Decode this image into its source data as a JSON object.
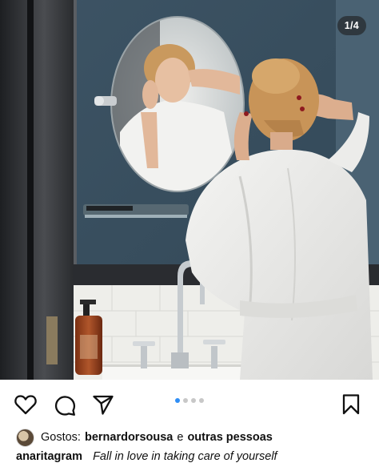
{
  "post": {
    "image_counter": "1/4",
    "carousel": {
      "total": 4,
      "active_index": 0
    },
    "likes": {
      "prefix": "Gostos:",
      "user": "bernardorsousa",
      "joiner": "e",
      "others": "outras pessoas"
    },
    "caption": {
      "username": "anaritagram",
      "text": "Fall in love in taking care of yourself"
    }
  },
  "actions": {
    "like_icon": "heart-icon",
    "comment_icon": "comment-icon",
    "share_icon": "send-icon",
    "save_icon": "bookmark-icon"
  },
  "colors": {
    "accent_dot": "#2f8ef5",
    "inactive_dot": "#c8c8c8",
    "text": "#111111"
  }
}
